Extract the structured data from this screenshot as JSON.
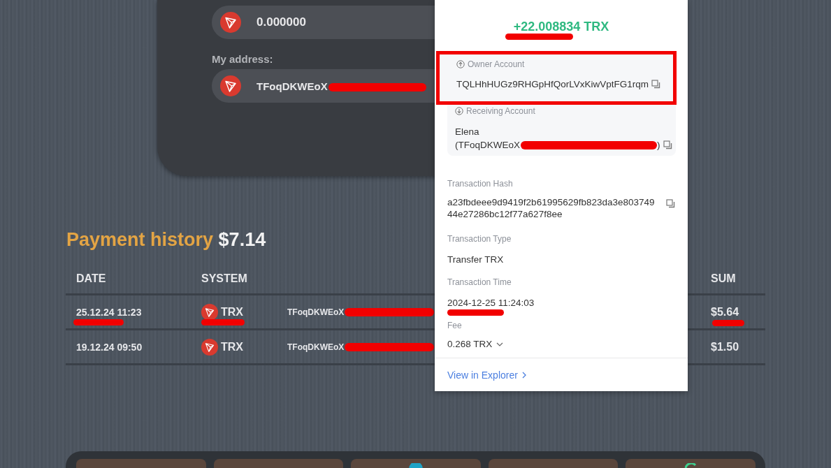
{
  "wallet": {
    "balance": "0.000000",
    "address_label": "My address:",
    "address": "TFoqDKWEoX",
    "address_redacted": true
  },
  "payment_history": {
    "title": "Payment history",
    "total": "$7.14",
    "columns": [
      "DATE",
      "SYSTEM",
      "SUM"
    ],
    "rows": [
      {
        "date": "25.12.24 11:23",
        "date_marked": true,
        "system": "TRX",
        "system_marked": true,
        "address": "TFoqDKWEoX",
        "address_redacted": true,
        "sum": "$5.64",
        "sum_marked": true
      },
      {
        "date": "19.12.24 09:50",
        "date_marked": false,
        "system": "TRX",
        "system_marked": false,
        "address": "TFoqDKWEoX",
        "address_redacted": true,
        "sum": "$1.50",
        "sum_marked": false
      }
    ]
  },
  "transaction": {
    "amount": "+22.008834 TRX",
    "amount_marked": true,
    "owner_account": {
      "label": "Owner Account",
      "value": "TQLHhHUGz9RHGpHfQorLVxKiwVptFG1rqm",
      "highlighted": true
    },
    "receiving_account": {
      "label": "Receiving Account",
      "name": "Elena",
      "address": "(TFoqDKWEoX",
      "address_redacted": true,
      "address_end": ")"
    },
    "hash": {
      "label": "Transaction Hash",
      "value": "a23fbdeee9d9419f2b61995629fb823da3e80374944e27286bc12f77a627f8ee"
    },
    "type": {
      "label": "Transaction Type",
      "value": "Transfer TRX"
    },
    "time": {
      "label": "Transaction Time",
      "value": "2024-12-25 11:24:03",
      "marked": true
    },
    "fee": {
      "label": "Fee",
      "value": "0.268 TRX"
    },
    "explorer_link": "View in Explorer"
  },
  "dock": {
    "tiles": [
      {
        "kind": "blank"
      },
      {
        "kind": "blank"
      },
      {
        "kind": "teal-dot"
      },
      {
        "kind": "blank"
      },
      {
        "kind": "green-arc"
      }
    ]
  }
}
